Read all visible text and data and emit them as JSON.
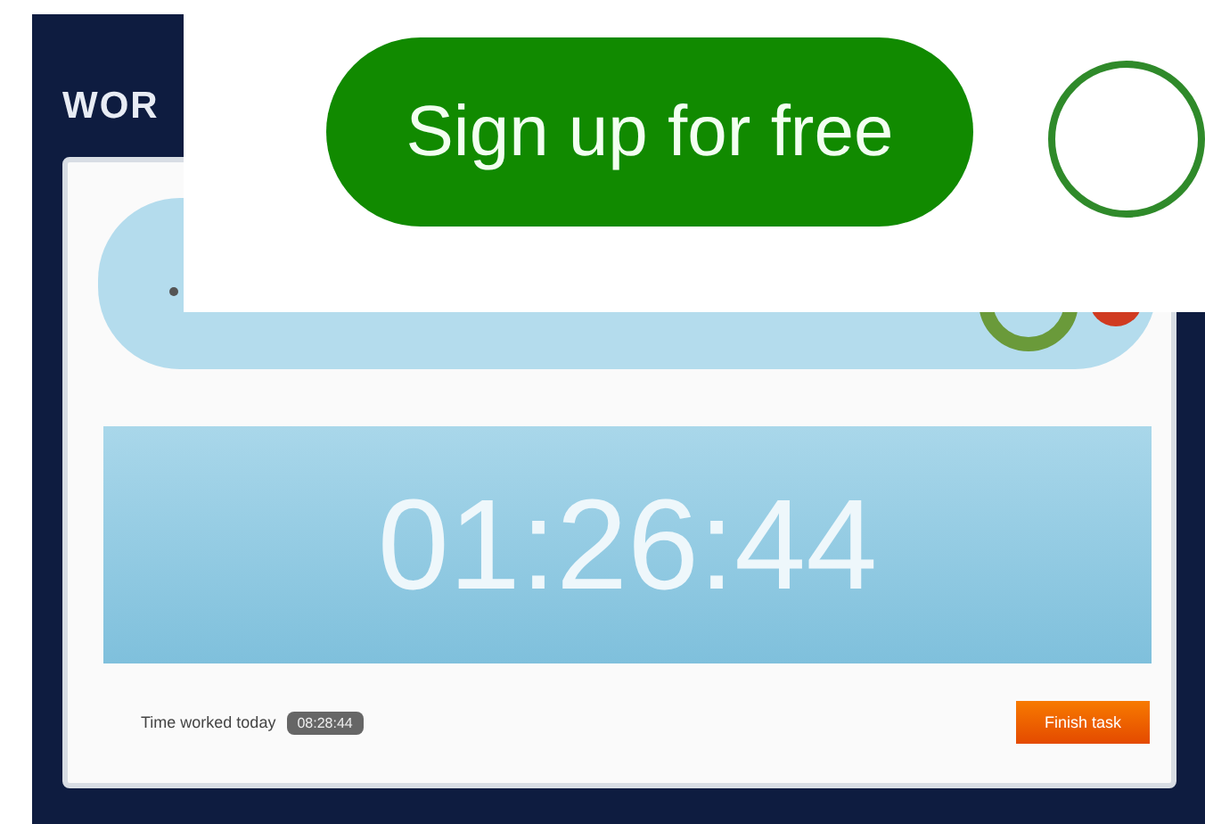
{
  "logo": {
    "text": "WOR"
  },
  "timer": {
    "display": "01:26:44"
  },
  "footer": {
    "label": "Time worked today",
    "total": "08:28:44",
    "button": "Finish task"
  },
  "signup_banner": {
    "button": "Sign up for free"
  }
}
